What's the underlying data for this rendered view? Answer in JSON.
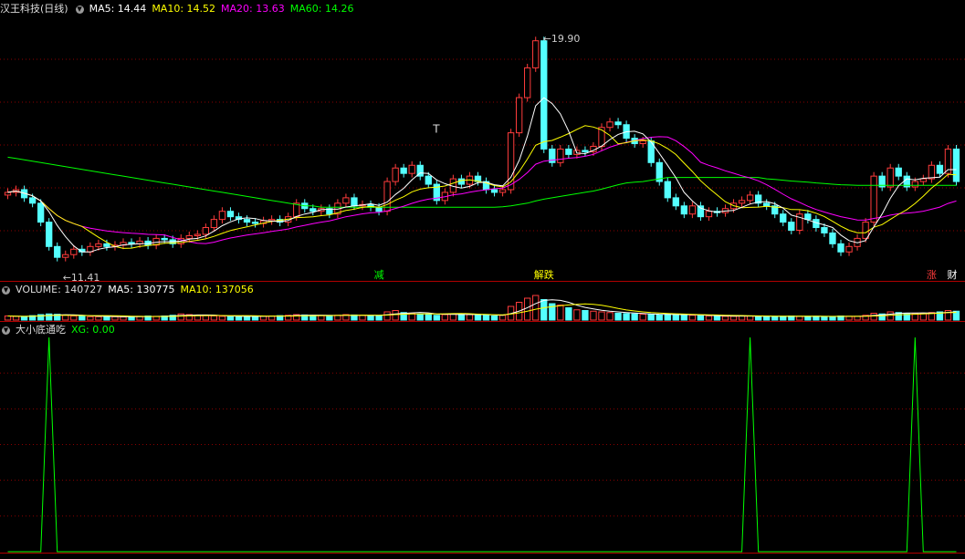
{
  "header_price": {
    "title": "汉王科技(日线)",
    "ma5": "MA5: 14.44",
    "ma10": "MA10: 14.52",
    "ma20": "MA20: 13.63",
    "ma60": "MA60: 14.26"
  },
  "header_volume": {
    "title": "VOLUME: 140727",
    "ma5": "MA5: 130775",
    "ma10": "MA10: 137056"
  },
  "header_indicator": {
    "title": "大小底通吃",
    "xg": "XG: 0.00"
  },
  "annotations": {
    "high_label": "19.90",
    "low_label": "11.41",
    "t_marker": "T",
    "event_jian": "减",
    "event_diedie": "解跌",
    "event_zhang": "涨",
    "event_cai": "财"
  },
  "colors": {
    "up": "#ff3c3c",
    "down": "#54ffff",
    "ma5": "#ffffff",
    "ma10": "#ffff00",
    "ma20": "#ff00ff",
    "ma60": "#00ff00",
    "grid": "#8b0000",
    "xg": "#00ff00"
  },
  "chart_data": {
    "type": "candlestick",
    "title": "汉王科技(日线)",
    "ylim": [
      11.0,
      20.5
    ],
    "high": 19.9,
    "low": 11.41,
    "ma_latest": {
      "MA5": 14.44,
      "MA10": 14.52,
      "MA20": 13.63,
      "MA60": 14.26
    },
    "close": [
      14.0,
      14.1,
      13.8,
      13.6,
      12.9,
      12.0,
      11.6,
      11.7,
      11.9,
      11.8,
      12.0,
      12.1,
      12.0,
      12.05,
      12.15,
      12.1,
      12.2,
      12.05,
      12.3,
      12.25,
      12.1,
      12.3,
      12.4,
      12.45,
      12.7,
      13.0,
      13.3,
      13.1,
      13.0,
      12.9,
      12.85,
      12.95,
      13.0,
      12.9,
      13.1,
      13.6,
      13.4,
      13.3,
      13.4,
      13.2,
      13.6,
      13.8,
      13.5,
      13.55,
      13.45,
      13.3,
      14.4,
      14.9,
      14.7,
      15.0,
      14.6,
      14.3,
      13.7,
      14.0,
      14.5,
      14.3,
      14.6,
      14.4,
      14.1,
      14.0,
      14.1,
      16.2,
      17.5,
      18.6,
      19.6,
      15.6,
      15.1,
      15.6,
      15.4,
      15.55,
      15.5,
      15.7,
      16.4,
      16.6,
      16.5,
      16.0,
      15.8,
      15.9,
      15.1,
      14.4,
      13.8,
      13.5,
      13.2,
      13.5,
      13.1,
      13.3,
      13.25,
      13.4,
      13.6,
      13.7,
      13.9,
      13.6,
      13.5,
      13.2,
      12.9,
      12.6,
      13.2,
      13.0,
      12.7,
      12.5,
      12.1,
      11.8,
      12.0,
      12.3,
      12.9,
      14.6,
      14.2,
      14.9,
      14.6,
      14.2,
      14.4,
      14.5,
      15.0,
      14.7,
      15.6,
      14.4
    ],
    "ma60": [
      15.3,
      15.25,
      15.2,
      15.15,
      15.1,
      15.05,
      15.0,
      14.95,
      14.9,
      14.85,
      14.8,
      14.75,
      14.7,
      14.65,
      14.6,
      14.55,
      14.5,
      14.45,
      14.4,
      14.35,
      14.3,
      14.25,
      14.2,
      14.15,
      14.1,
      14.05,
      14.0,
      13.95,
      13.9,
      13.85,
      13.8,
      13.75,
      13.7,
      13.65,
      13.6,
      13.55,
      13.5,
      13.5,
      13.45,
      13.45,
      13.45,
      13.45,
      13.45,
      13.45,
      13.45,
      13.45,
      13.45,
      13.45,
      13.45,
      13.45,
      13.45,
      13.45,
      13.45,
      13.45,
      13.45,
      13.45,
      13.45,
      13.45,
      13.45,
      13.45,
      13.47,
      13.5,
      13.55,
      13.6,
      13.68,
      13.75,
      13.8,
      13.85,
      13.9,
      13.95,
      14.0,
      14.05,
      14.12,
      14.2,
      14.28,
      14.35,
      14.38,
      14.4,
      14.45,
      14.5,
      14.55,
      14.55,
      14.55,
      14.55,
      14.55,
      14.55,
      14.55,
      14.55,
      14.55,
      14.55,
      14.55,
      14.55,
      14.5,
      14.48,
      14.45,
      14.42,
      14.4,
      14.38,
      14.35,
      14.33,
      14.3,
      14.28,
      14.27,
      14.26,
      14.26,
      14.26,
      14.26,
      14.26,
      14.26,
      14.26,
      14.26,
      14.26,
      14.26,
      14.26,
      14.26,
      14.26
    ],
    "volume": [
      60,
      55,
      50,
      65,
      80,
      90,
      85,
      70,
      60,
      55,
      50,
      50,
      55,
      50,
      45,
      50,
      55,
      60,
      55,
      60,
      70,
      90,
      80,
      70,
      65,
      60,
      55,
      50,
      50,
      60,
      55,
      60,
      60,
      65,
      70,
      80,
      75,
      70,
      65,
      60,
      70,
      80,
      75,
      70,
      65,
      60,
      120,
      140,
      110,
      100,
      90,
      85,
      70,
      80,
      90,
      85,
      80,
      75,
      70,
      60,
      70,
      200,
      260,
      320,
      360,
      300,
      240,
      220,
      180,
      150,
      140,
      130,
      120,
      110,
      100,
      95,
      90,
      85,
      80,
      80,
      85,
      80,
      75,
      70,
      65,
      60,
      60,
      55,
      55,
      60,
      60,
      55,
      55,
      50,
      55,
      60,
      55,
      55,
      55,
      50,
      50,
      60,
      55,
      55,
      70,
      100,
      90,
      120,
      110,
      100,
      95,
      100,
      110,
      120,
      140,
      130
    ],
    "xg_signal_index": [
      5,
      90,
      110
    ]
  }
}
